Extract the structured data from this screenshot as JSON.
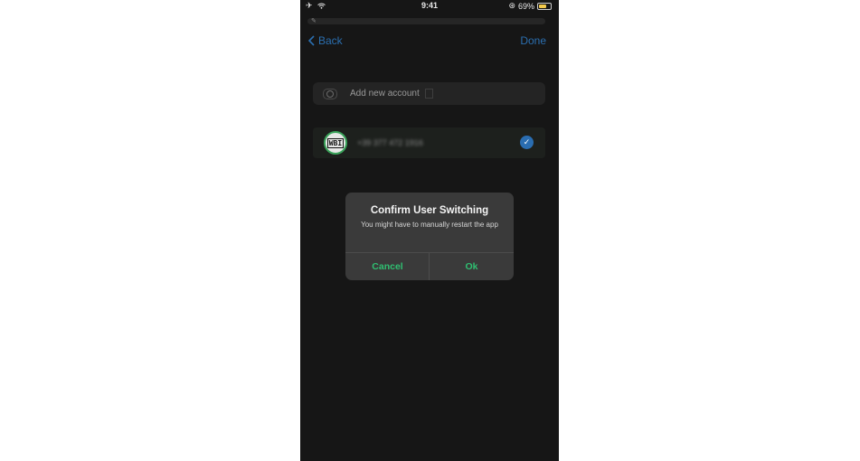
{
  "status_bar": {
    "time": "9:41",
    "battery_percent": "69%",
    "battery_level": 0.69,
    "icons": [
      "airplane-icon",
      "wifi-icon",
      "orientation-lock-icon",
      "battery-icon"
    ]
  },
  "nav": {
    "back_label": "Back",
    "done_label": "Done"
  },
  "accounts": {
    "add_label": "Add new account",
    "items": [
      {
        "avatar_text": "WBI",
        "phone_number": "+39 377 472 1916",
        "selected": true
      }
    ]
  },
  "dialog": {
    "title": "Confirm User Switching",
    "message": "You might have to manually restart the app",
    "cancel_label": "Cancel",
    "ok_label": "Ok"
  },
  "colors": {
    "accent_blue": "#2b6fb0",
    "action_green": "#2fbf71",
    "background": "#161616"
  }
}
